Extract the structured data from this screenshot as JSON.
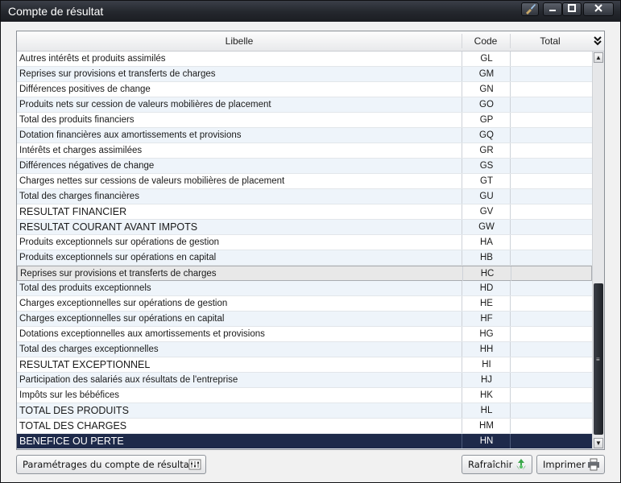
{
  "window": {
    "title": "Compte de résultat"
  },
  "titlebar_icons": {
    "brush": "brush-icon",
    "minimize": "minimize-icon",
    "maximize": "maximize-icon",
    "close": "close-icon"
  },
  "table": {
    "columns": [
      "Libelle",
      "Code",
      "Total"
    ],
    "rows": [
      {
        "label": "Autres intérêts et produits assimilés",
        "code": "GL",
        "total": ""
      },
      {
        "label": "Reprises sur provisions et transferts de charges",
        "code": "GM",
        "total": ""
      },
      {
        "label": "Différences positives de change",
        "code": "GN",
        "total": ""
      },
      {
        "label": "Produits nets sur cession de valeurs mobilières de placement",
        "code": "GO",
        "total": ""
      },
      {
        "label": "Total des produits financiers",
        "code": "GP",
        "total": ""
      },
      {
        "label": "Dotation financières aux amortissements et provisions",
        "code": "GQ",
        "total": ""
      },
      {
        "label": "Intérêts et charges assimilées",
        "code": "GR",
        "total": ""
      },
      {
        "label": "Différences négatives de change",
        "code": "GS",
        "total": ""
      },
      {
        "label": "Charges nettes sur cessions de valeurs mobilières de placement",
        "code": "GT",
        "total": ""
      },
      {
        "label": "Total des charges financières",
        "code": "GU",
        "total": ""
      },
      {
        "label": "RESULTAT FINANCIER",
        "code": "GV",
        "total": ""
      },
      {
        "label": "RESULTAT COURANT AVANT IMPOTS",
        "code": "GW",
        "total": ""
      },
      {
        "label": "Produits exceptionnels sur opérations de gestion",
        "code": "HA",
        "total": ""
      },
      {
        "label": "Produits exceptionnels sur opérations en capital",
        "code": "HB",
        "total": ""
      },
      {
        "label": "Reprises sur provisions et transferts de charges",
        "code": "HC",
        "total": ""
      },
      {
        "label": "Total des produits exceptionnels",
        "code": "HD",
        "total": ""
      },
      {
        "label": "Charges exceptionnelles sur opérations de gestion",
        "code": "HE",
        "total": ""
      },
      {
        "label": "Charges exceptionnelles sur opérations en capital",
        "code": "HF",
        "total": ""
      },
      {
        "label": "Dotations exceptionnelles aux amortissements et provisions",
        "code": "HG",
        "total": ""
      },
      {
        "label": "Total des charges exceptionnelles",
        "code": "HH",
        "total": ""
      },
      {
        "label": "RESULTAT EXCEPTIONNEL",
        "code": "HI",
        "total": ""
      },
      {
        "label": "Participation des salariés aux résultats de l'entreprise",
        "code": "HJ",
        "total": ""
      },
      {
        "label": "Impôts sur les bébéfices",
        "code": "HK",
        "total": ""
      },
      {
        "label": "TOTAL DES PRODUITS",
        "code": "HL",
        "total": ""
      },
      {
        "label": "TOTAL DES CHARGES",
        "code": "HM",
        "total": ""
      },
      {
        "label": "BENEFICE OU PERTE",
        "code": "HN",
        "total": ""
      }
    ]
  },
  "buttons": {
    "settings": "Paramétrages du compte de résultat",
    "refresh": "Rafraîchir",
    "print": "Imprimer"
  },
  "colors": {
    "titlebar": "#24272d",
    "selected_row": "#e8e8e8",
    "final_row": "#1e2a4a",
    "alt_row": "#eef4fa"
  }
}
